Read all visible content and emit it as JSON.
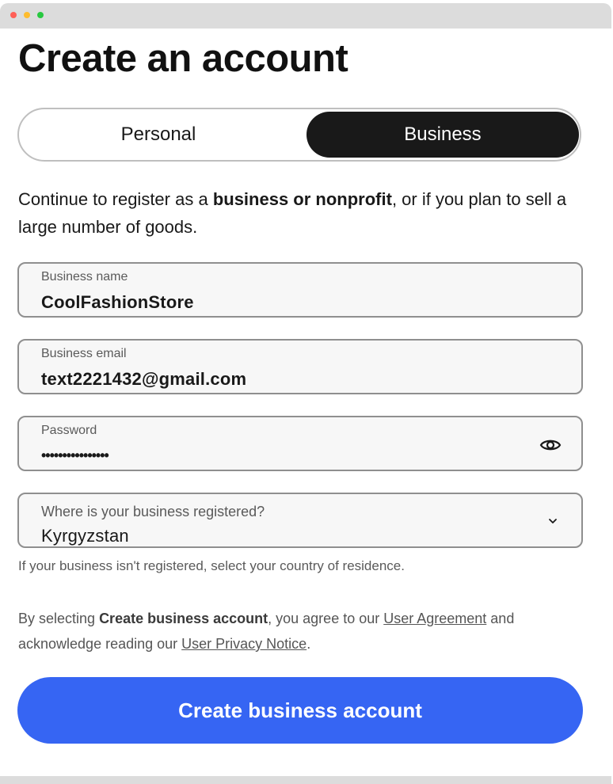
{
  "page": {
    "title": "Create an account"
  },
  "account_type": {
    "personal_label": "Personal",
    "business_label": "Business",
    "selected": "Business"
  },
  "intro": {
    "part1": "Continue to register as a ",
    "bold": "business or nonprofit",
    "part2": ", or if you plan to sell a large number of goods."
  },
  "fields": {
    "business_name": {
      "label": "Business name",
      "value": "CoolFashionStore"
    },
    "business_email": {
      "label": "Business email",
      "value": "text2221432@gmail.com"
    },
    "password": {
      "label": "Password",
      "value": "••••••••••••••••"
    },
    "country": {
      "label": "Where is your business registered?",
      "value": "Kyrgyzstan"
    }
  },
  "helper_text": "If your business isn't registered, select your country of residence.",
  "legal": {
    "prefix": "By selecting ",
    "bold": "Create business account",
    "middle": ", you agree to our ",
    "link1": "User Agreement",
    "middle2": " and acknowledge reading our ",
    "link2": "User Privacy Notice",
    "suffix": "."
  },
  "cta_label": "Create business account",
  "icons": {
    "password_toggle": "eye-icon",
    "dropdown": "chevron-down-icon"
  },
  "colors": {
    "primary": "#3665f3",
    "toggle_active": "#191919"
  }
}
